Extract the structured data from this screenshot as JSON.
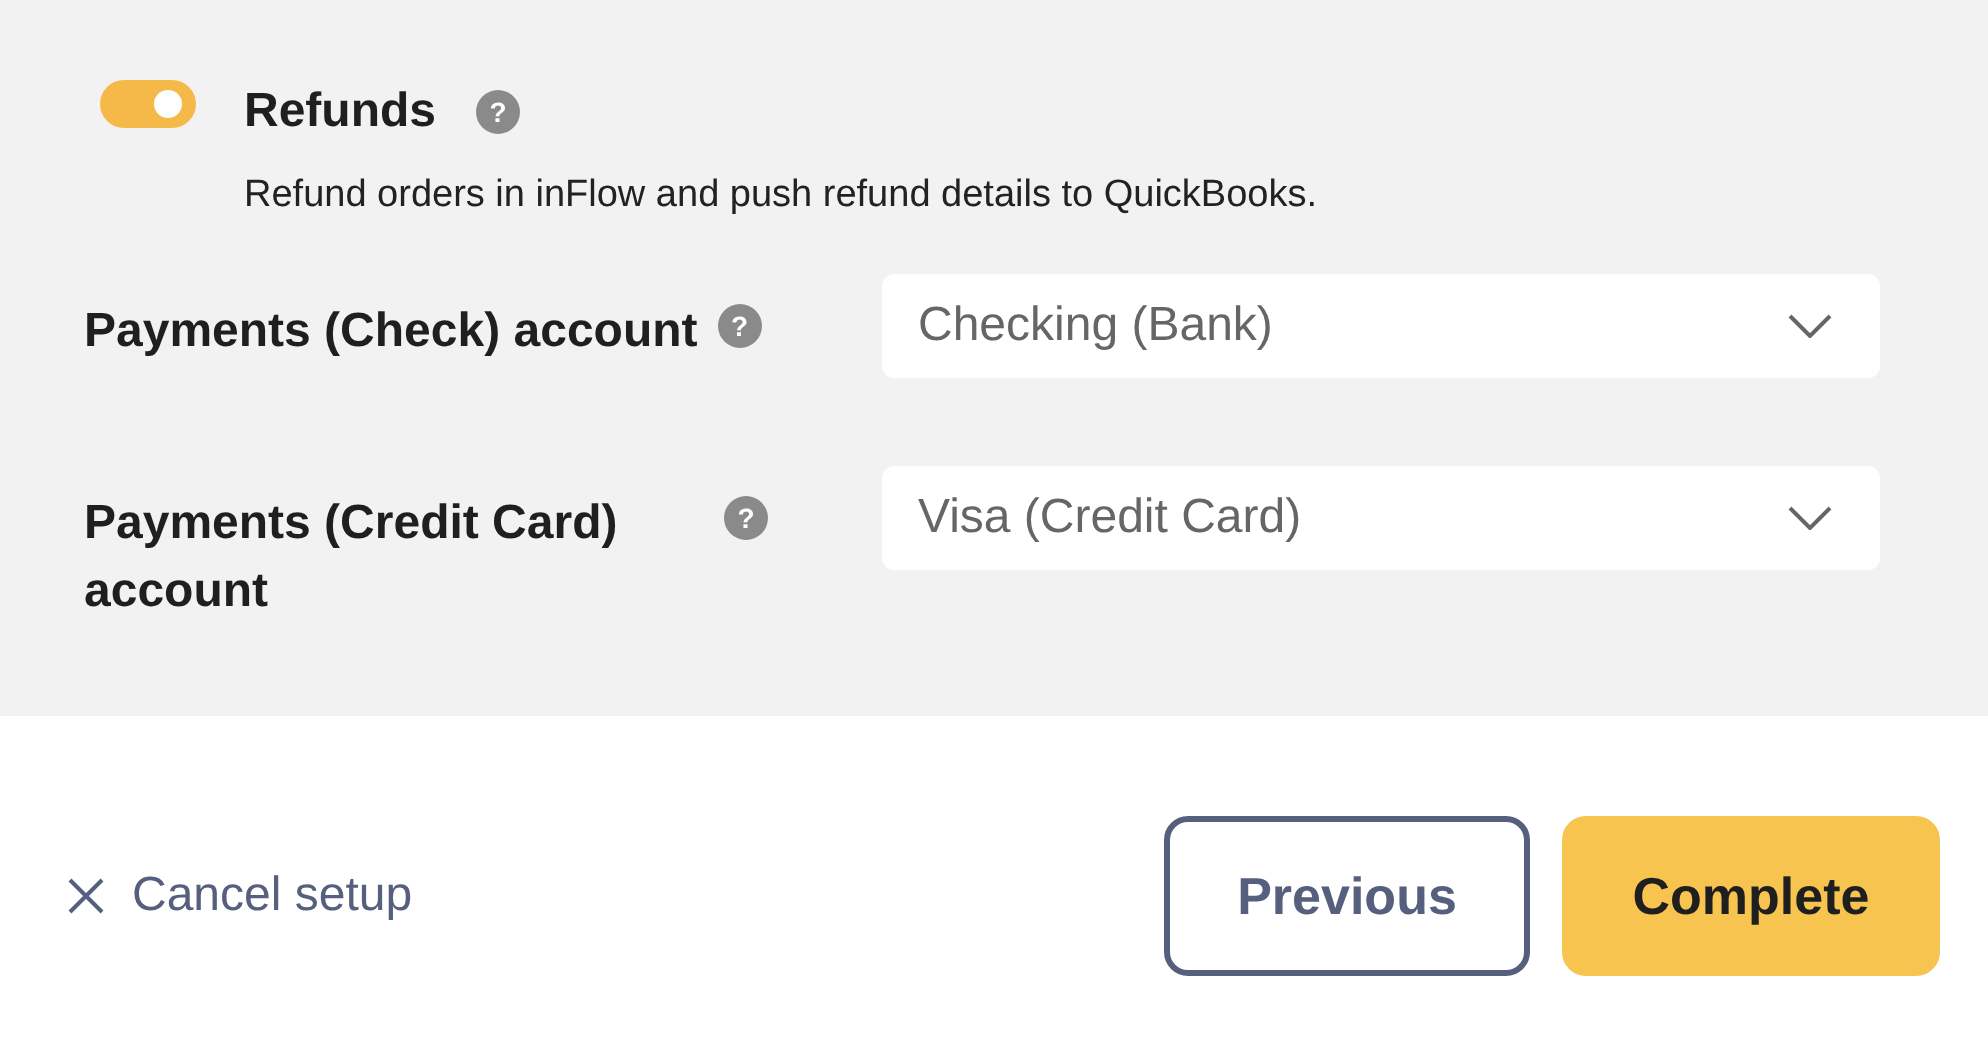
{
  "refunds": {
    "on": true,
    "title": "Refunds",
    "help": "?",
    "description": "Refund orders in inFlow and push refund details to QuickBooks."
  },
  "accounts": [
    {
      "label": "Payments (Check) account",
      "help": "?",
      "value": "Checking (Bank)"
    },
    {
      "label": "Payments (Credit Card) account",
      "help": "?",
      "value": "Visa (Credit Card)"
    }
  ],
  "footer": {
    "cancel": "Cancel setup",
    "buttons": [
      {
        "label": "Previous",
        "kind": "secondary"
      },
      {
        "label": "Complete",
        "kind": "primary"
      }
    ]
  }
}
